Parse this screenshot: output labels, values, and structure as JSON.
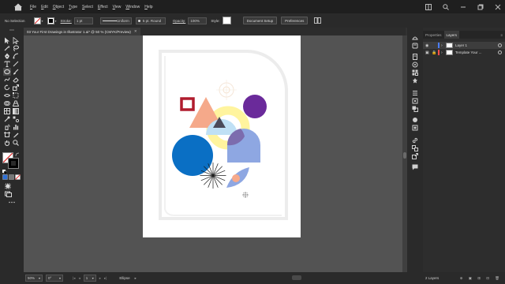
{
  "menubar": {
    "items": [
      "File",
      "Edit",
      "Object",
      "Type",
      "Select",
      "Effect",
      "View",
      "Window",
      "Help"
    ]
  },
  "control": {
    "selection_label": "No Selection",
    "stroke_label": "Stroke:",
    "stroke_value": "1 pt",
    "uniform_label": "Uniform",
    "brush_label": "5 pt. Round",
    "opacity_label": "Opacity:",
    "opacity_value": "100%",
    "style_label": "Style:",
    "doc_setup_label": "Document Setup",
    "preferences_label": "Preferences"
  },
  "document": {
    "tab_title": "03 Your First Drawings in Illustrator 1.ai* @ 50 % (CMYK/Preview)"
  },
  "panel": {
    "tabs": [
      "Properties",
      "Layers"
    ],
    "active_tab": "Layers",
    "layers": [
      {
        "name": "Layer 1",
        "color": "#4a7dff"
      },
      {
        "name": "Template Your ...",
        "color": "#ff4d4d"
      }
    ],
    "footer_count": "2 Layers"
  },
  "status": {
    "zoom": "50%",
    "angle": "0°",
    "artboard_num": "1",
    "tool_name": "Ellipse"
  },
  "colors": {
    "square_red": "#b01c2e",
    "triangle_peach": "#f5a98a",
    "circle_purple": "#6a2a9a",
    "circle_blue": "#0a6fc4",
    "ring_yellow": "#fff49e",
    "arch_lavender": "#8ea7e2",
    "dark_triangle": "#4a4a5a"
  }
}
